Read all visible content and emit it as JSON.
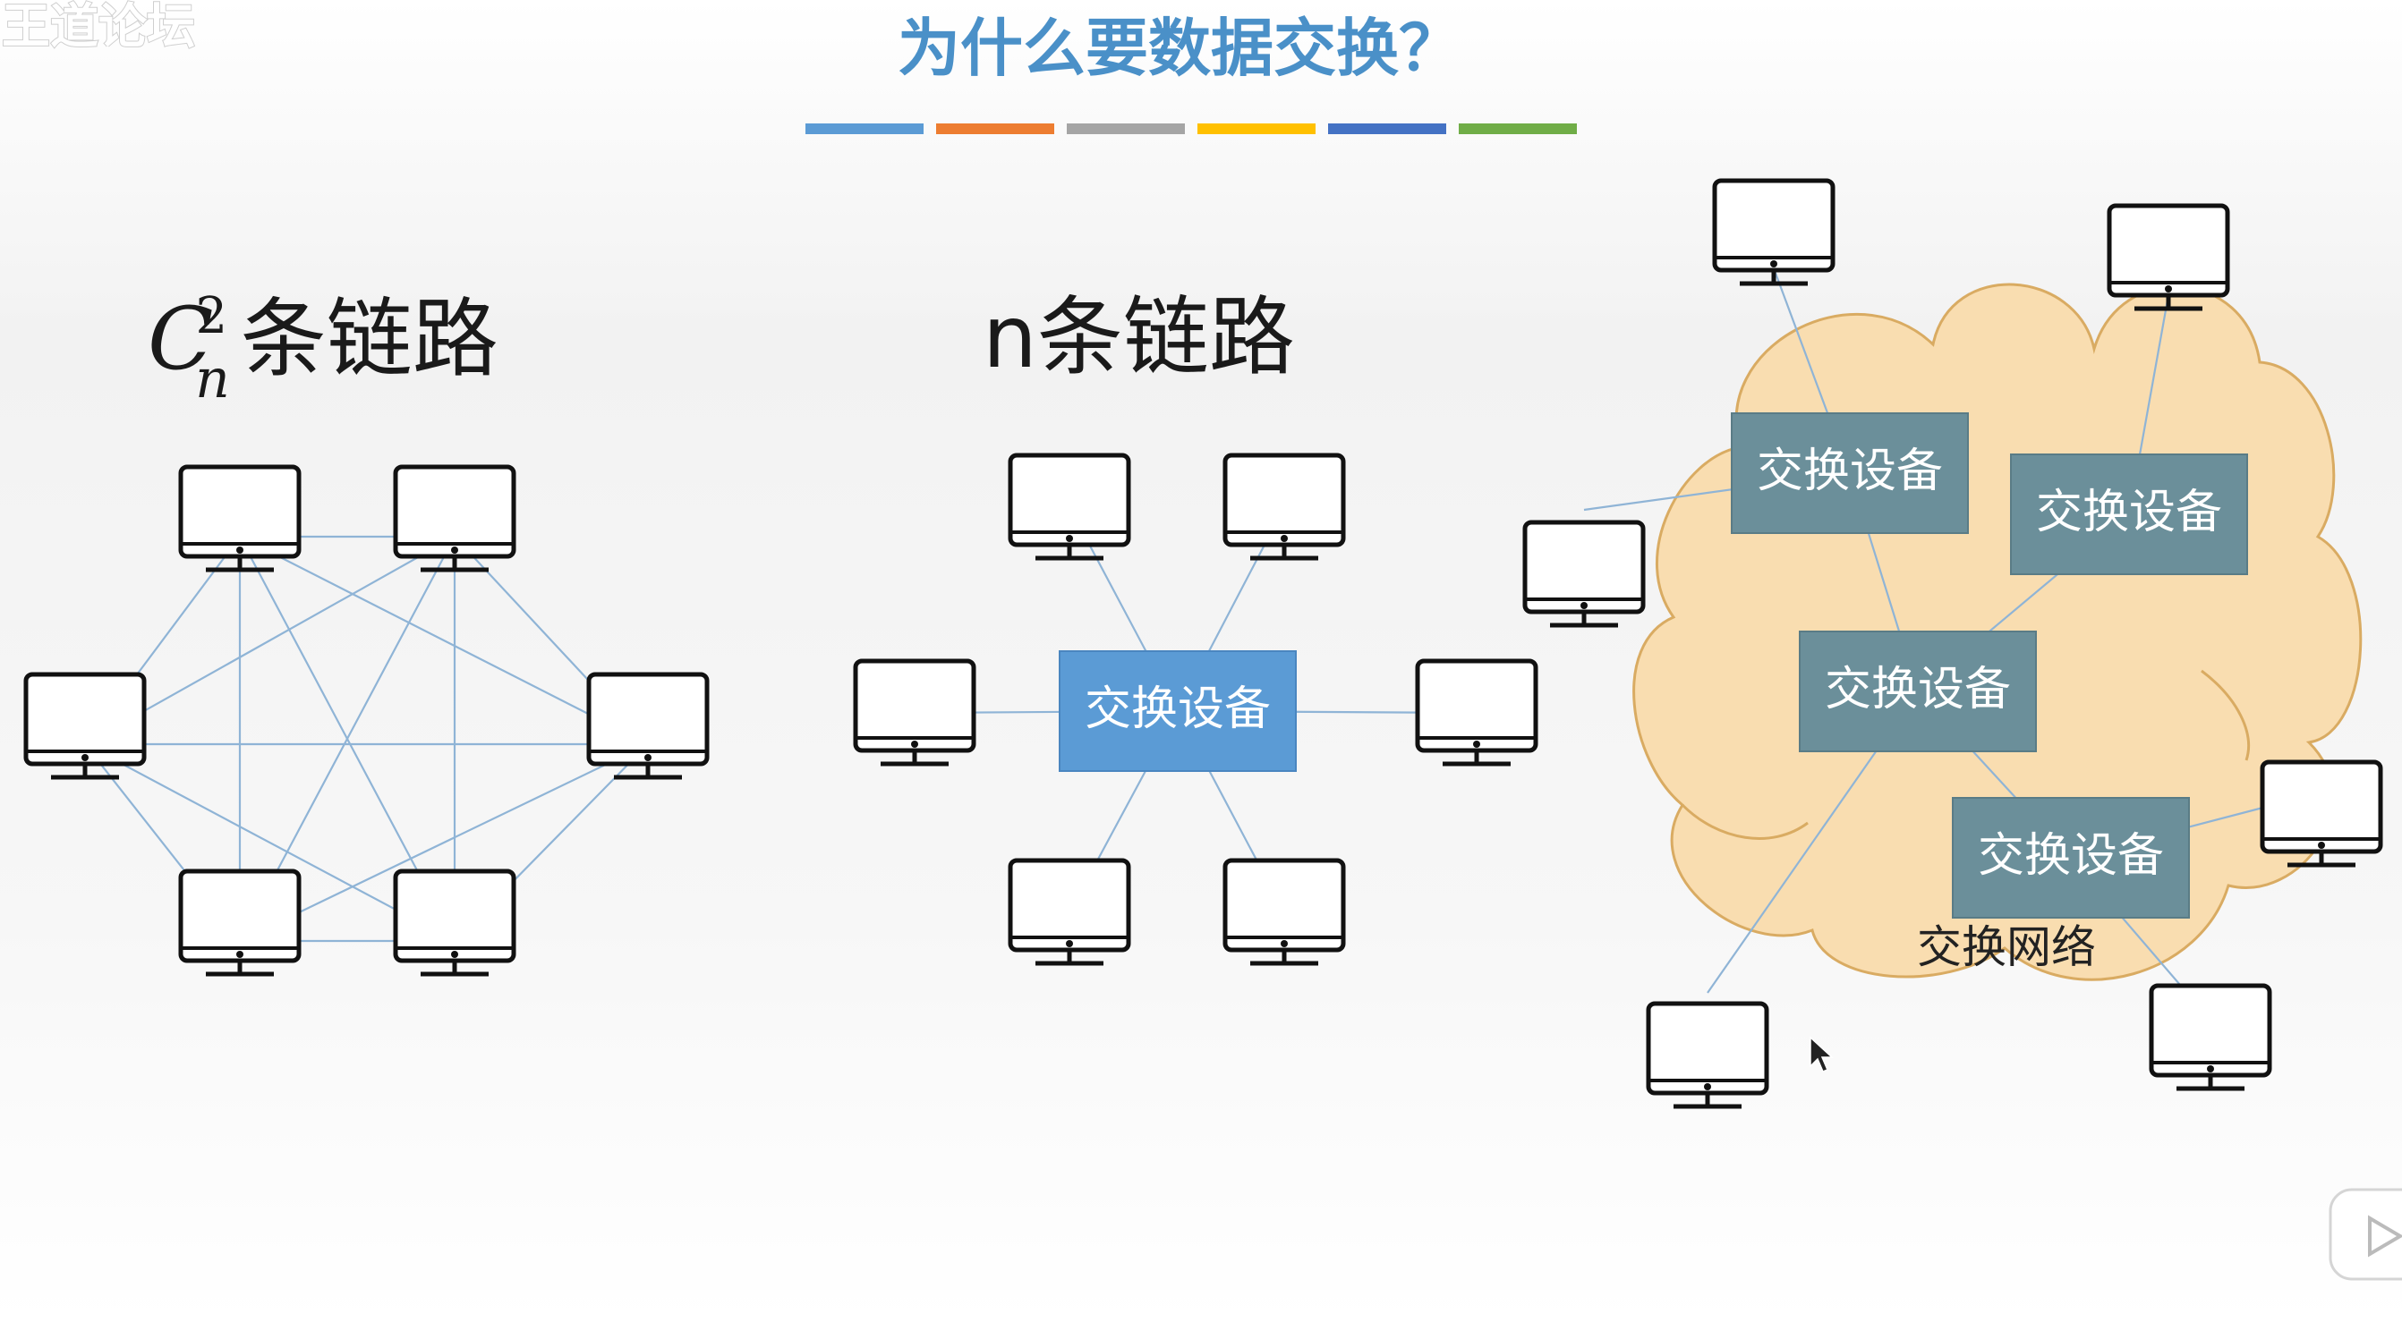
{
  "watermark": "王道论坛",
  "title": "为什么要数据交换？",
  "title_bar_colors": [
    "#5b9bd5",
    "#ed7d31",
    "#a5a5a5",
    "#ffc000",
    "#4472c4",
    "#70ad47"
  ],
  "panels": {
    "mesh": {
      "heading_base": "C",
      "heading_sup": "2",
      "heading_sub": "n",
      "heading_text": "条链路"
    },
    "star": {
      "heading": "n条链路",
      "switch_label": "交换设备"
    },
    "network": {
      "switch_labels": [
        "交换设备",
        "交换设备",
        "交换设备",
        "交换设备"
      ],
      "network_label": "交换网络"
    }
  },
  "colors": {
    "link": "#8fb4d6",
    "star_switch": "#5b9bd5",
    "net_switch": "#6b8f9a",
    "cloud_fill": "#f9ddb0",
    "cloud_stroke": "#d9ab62"
  },
  "icons": {
    "computer": "computer-monitor-icon",
    "cursor": "mouse-pointer-icon",
    "play": "play-button-icon"
  }
}
